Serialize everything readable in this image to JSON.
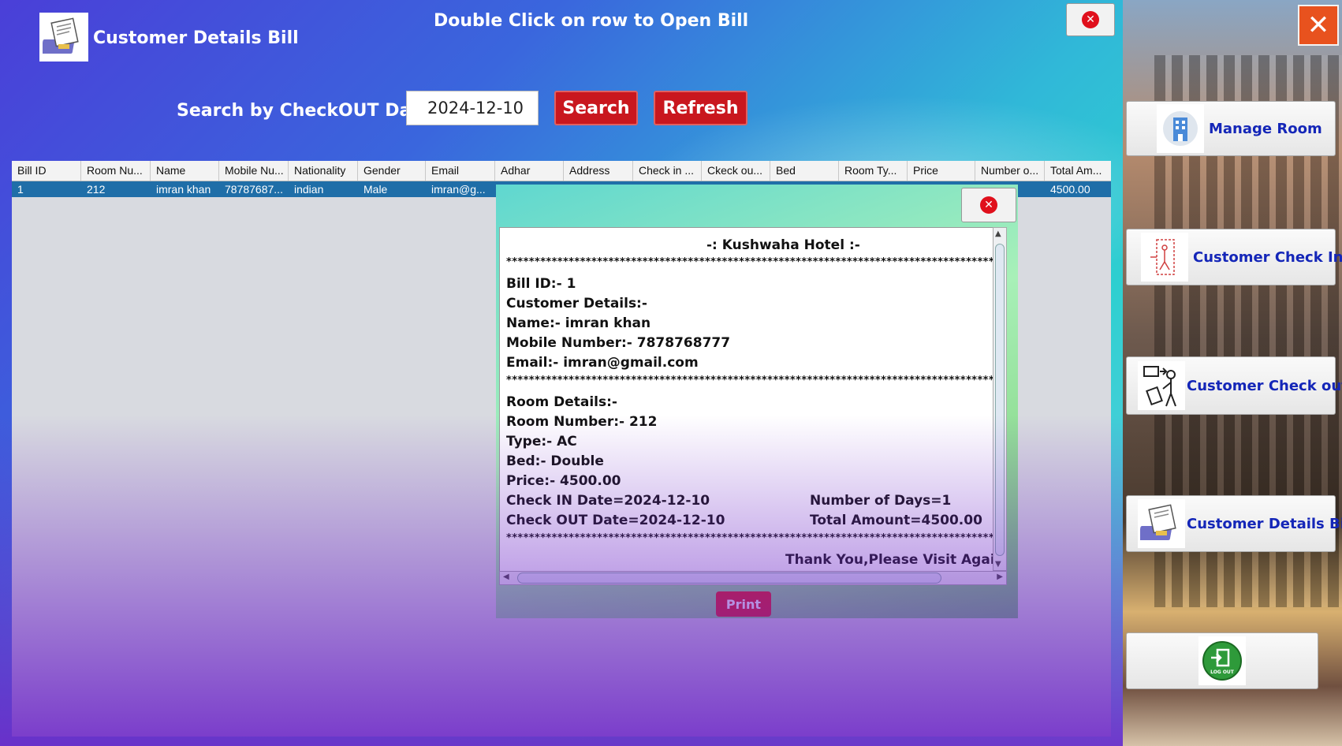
{
  "header": {
    "title": "Customer Details Bill",
    "hint": "Double Click on row to Open Bill"
  },
  "search": {
    "label": "Search by CheckOUT Date",
    "date_value": "2024-12-10",
    "search_label": "Search",
    "refresh_label": "Refresh"
  },
  "table": {
    "columns": [
      "Bill ID",
      "Room Nu...",
      "Name",
      "Mobile Nu...",
      "Nationality",
      "Gender",
      "Email",
      "Adhar",
      "Address",
      "Check in ...",
      "Ckeck ou...",
      "Bed",
      "Room Ty...",
      "Price",
      "Number o...",
      "Total Am..."
    ],
    "row": {
      "bill_id": "1",
      "room": "212",
      "name": "imran khan",
      "mobile": "78787687...",
      "nationality": "indian",
      "gender": "Male",
      "email": "imran@g...",
      "total": "4500.00"
    }
  },
  "bill": {
    "hotel": "-: Kushwaha Hotel :-",
    "stars": "**********************************************************************************************",
    "bill_id": "Bill ID:- 1",
    "customer_details": "Customer Details:-",
    "name": "Name:- imran khan",
    "mobile": "Mobile Number:- 7878768777",
    "email": "Email:- imran@gmail.com",
    "room_details": "Room Details:-",
    "room_number": "Room Number:- 212",
    "type": "Type:- AC",
    "bed": "Bed:- Double",
    "price": "Price:- 4500.00",
    "check_in": "Check IN Date=2024-12-10",
    "days": "Number of Days=1",
    "check_out": "Check OUT Date=2024-12-10",
    "total": "Total Amount=4500.00",
    "thanks": "Thank You,Please Visit Again.",
    "print_label": "Print"
  },
  "sidebar": {
    "manage_room": "Manage Room",
    "check_in": "Customer Check In",
    "check_out": "Customer Check out",
    "details_bill": "Customer Details Bill",
    "logout_icon_text": "LOG OUT"
  }
}
